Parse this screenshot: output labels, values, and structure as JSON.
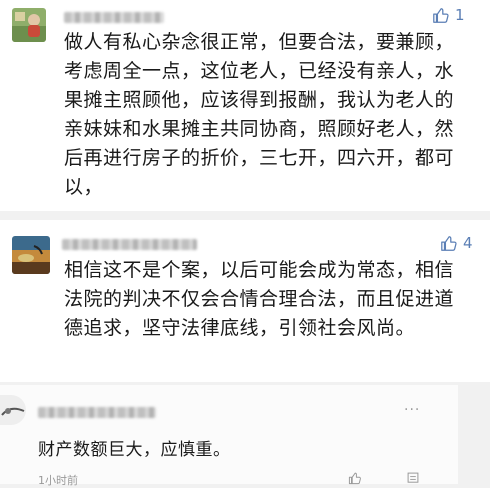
{
  "comments": [
    {
      "avatar": "avatar-photo",
      "like_icon": "thumb-up-icon",
      "like_count": "1",
      "text": "做人有私心杂念很正常，但要合法，要兼顾，考虑周全一点，这位老人，已经没有亲人，水果摊主照顾他，应该得到报酬，我认为老人的亲妹妹和水果摊主共同协商，照顾好老人，然后再进行房子的折价，三七开，四六开，都可以，"
    },
    {
      "avatar": "avatar-painting",
      "like_icon": "thumb-up-icon",
      "like_count": "4",
      "text": "相信这不是个案，以后可能会成为常态，相信法院的判决不仅会合情合理合法，而且促进道德追求，坚守法律底线，引领社会风尚。"
    },
    {
      "avatar": "avatar-sketch",
      "more_icon": "more-icon",
      "text": "财产数额巨大，应慎重。",
      "time": "1小时前",
      "like_icon": "thumb-up-icon",
      "reply_icon": "reply-icon"
    }
  ],
  "colors": {
    "like": "#5b7fb5",
    "background": "#f1f1f1"
  }
}
